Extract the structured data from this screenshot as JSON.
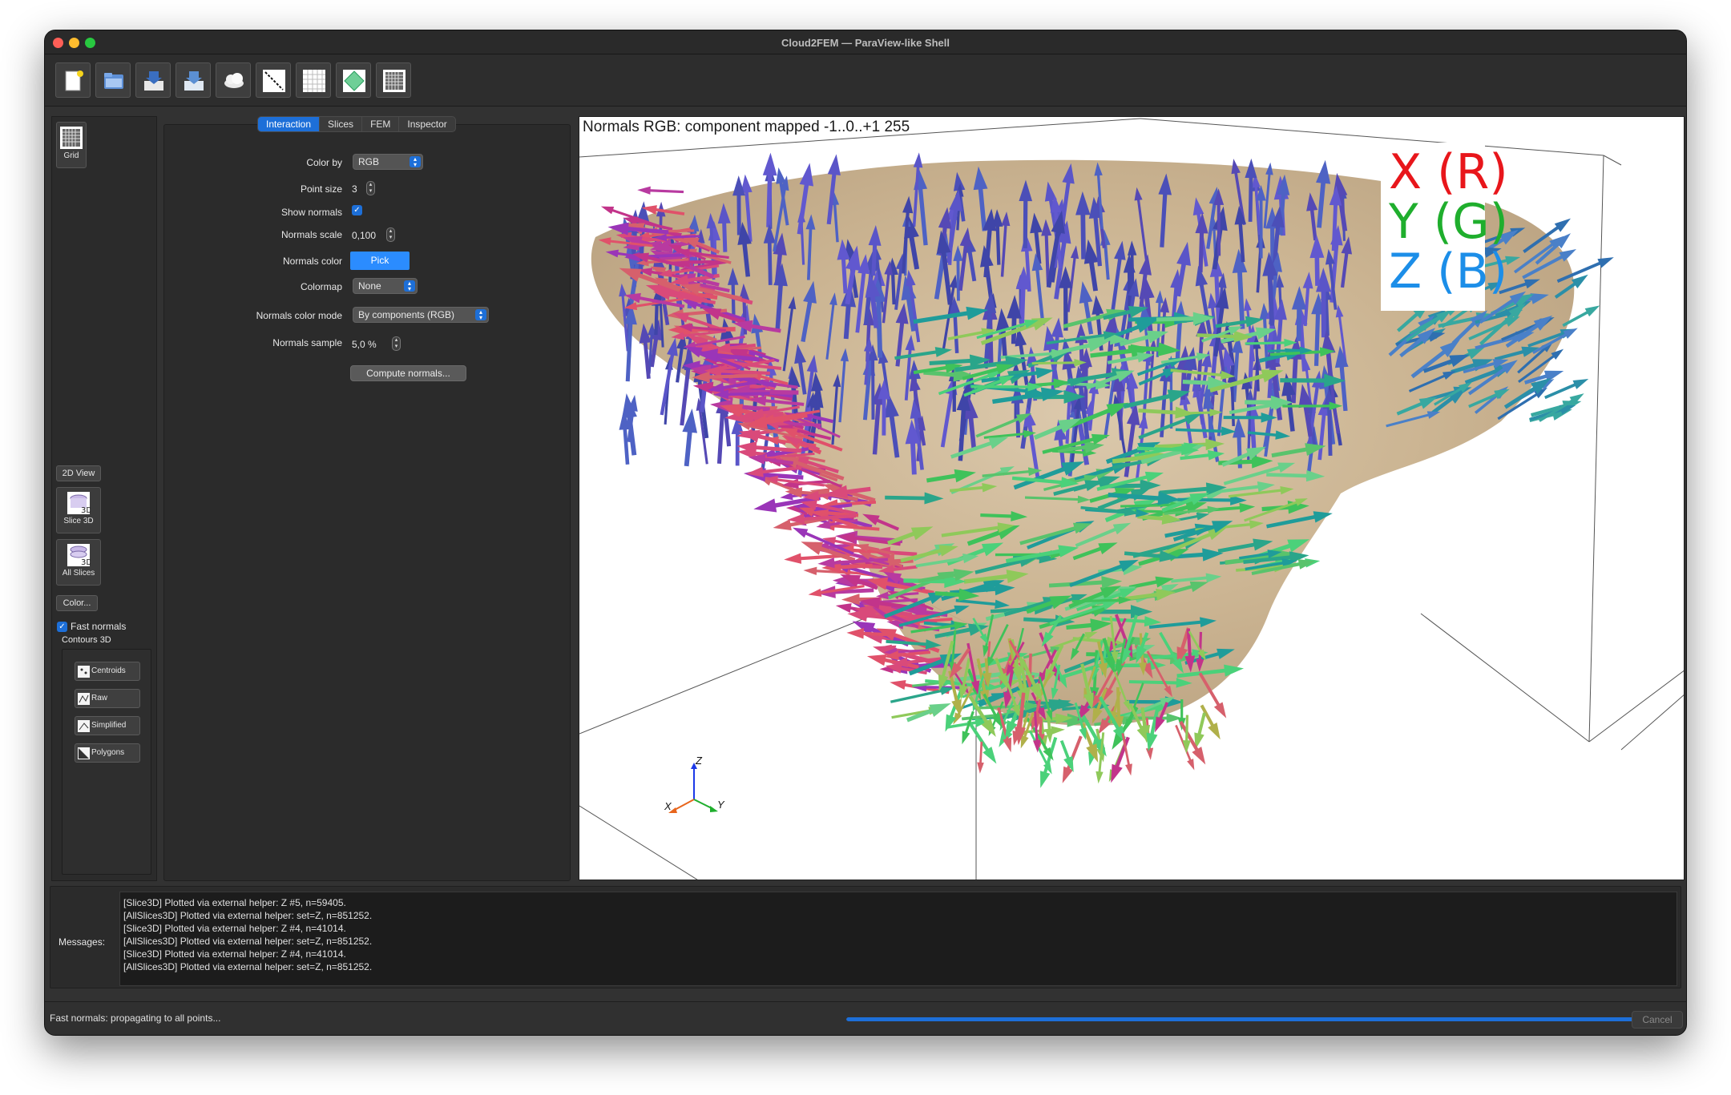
{
  "window": {
    "title": "Cloud2FEM — ParaView-like Shell"
  },
  "toolbar": {
    "icons": [
      "new-file-icon",
      "open-folder-icon",
      "import-cloud-icon",
      "import-mesh-icon",
      "cloud-icon",
      "line-icon",
      "grid-3d-icon",
      "plane-icon",
      "mesh-icon"
    ]
  },
  "leftbar": {
    "grid_label": "Grid",
    "view2d_label": "2D View",
    "slice3d_label": "Slice 3D",
    "allslices_label": "All Slices",
    "color_label": "Color...",
    "fast_normals_label": "Fast normals",
    "fast_normals_checked": true,
    "contours_title": "Contours 3D",
    "contours": [
      {
        "label": "Centroids"
      },
      {
        "label": "Raw"
      },
      {
        "label": "Simplified"
      },
      {
        "label": "Polygons"
      }
    ]
  },
  "tabs": [
    {
      "label": "Interaction",
      "active": true
    },
    {
      "label": "Slices",
      "active": false
    },
    {
      "label": "FEM",
      "active": false
    },
    {
      "label": "Inspector",
      "active": false
    }
  ],
  "form": {
    "color_by_label": "Color by",
    "color_by_value": "RGB",
    "point_size_label": "Point size",
    "point_size_value": "3",
    "show_normals_label": "Show normals",
    "show_normals_checked": true,
    "normals_scale_label": "Normals scale",
    "normals_scale_value": "0,100",
    "normals_color_label": "Normals color",
    "normals_color_button": "Pick",
    "colormap_label": "Colormap",
    "colormap_value": "None",
    "normals_color_mode_label": "Normals color mode",
    "normals_color_mode_value": "By components (RGB)",
    "normals_sample_label": "Normals sample",
    "normals_sample_value": "5,0 %",
    "compute_button": "Compute normals..."
  },
  "viewport": {
    "title": "Normals RGB: component mapped -1..0..+1 255",
    "legend": [
      {
        "label": "X (R)",
        "color": "#e8161b"
      },
      {
        "label": "Y (G)",
        "color": "#1fae2d"
      },
      {
        "label": "Z (B)",
        "color": "#1c8ee8"
      }
    ],
    "orientation_axes": {
      "x": "X",
      "y": "Y",
      "z": "Z"
    }
  },
  "messages": {
    "label": "Messages:",
    "lines": [
      "[Slice3D] Plotted via external helper: Z #5, n=59405.",
      "[AllSlices3D] Plotted via external helper: set=Z, n=851252.",
      "[Slice3D] Plotted via external helper: Z #4, n=41014.",
      "[AllSlices3D] Plotted via external helper: set=Z, n=851252.",
      "[Slice3D] Plotted via external helper: Z #4, n=41014.",
      "[AllSlices3D] Plotted via external helper: set=Z, n=851252."
    ]
  },
  "status": {
    "text": "Fast normals: propagating to all points...",
    "progress": 1.0,
    "cancel_label": "Cancel"
  }
}
